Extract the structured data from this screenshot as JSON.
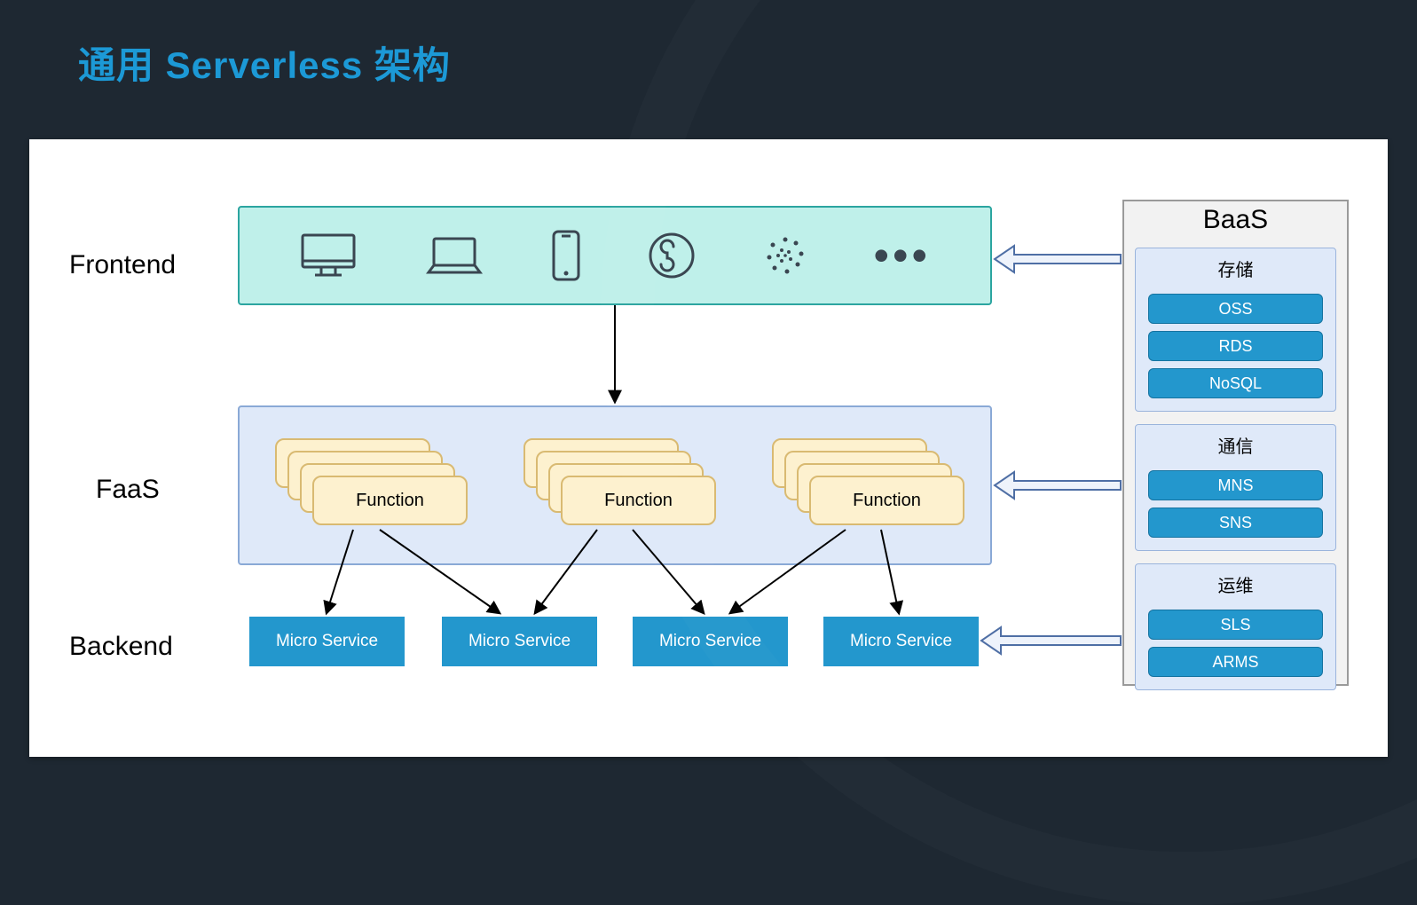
{
  "title": "通用 Serverless 架构",
  "layers": {
    "frontend": "Frontend",
    "faas": "FaaS",
    "backend": "Backend"
  },
  "frontend_icons": {
    "more": "•••"
  },
  "function_label": "Function",
  "microservices": [
    "Micro Service",
    "Micro Service",
    "Micro Service",
    "Micro Service"
  ],
  "baas": {
    "title": "BaaS",
    "groups": [
      {
        "title": "存储",
        "items": [
          "OSS",
          "RDS",
          "NoSQL"
        ]
      },
      {
        "title": "通信",
        "items": [
          "MNS",
          "SNS"
        ]
      },
      {
        "title": "运维",
        "items": [
          "SLS",
          "ARMS"
        ]
      }
    ]
  }
}
